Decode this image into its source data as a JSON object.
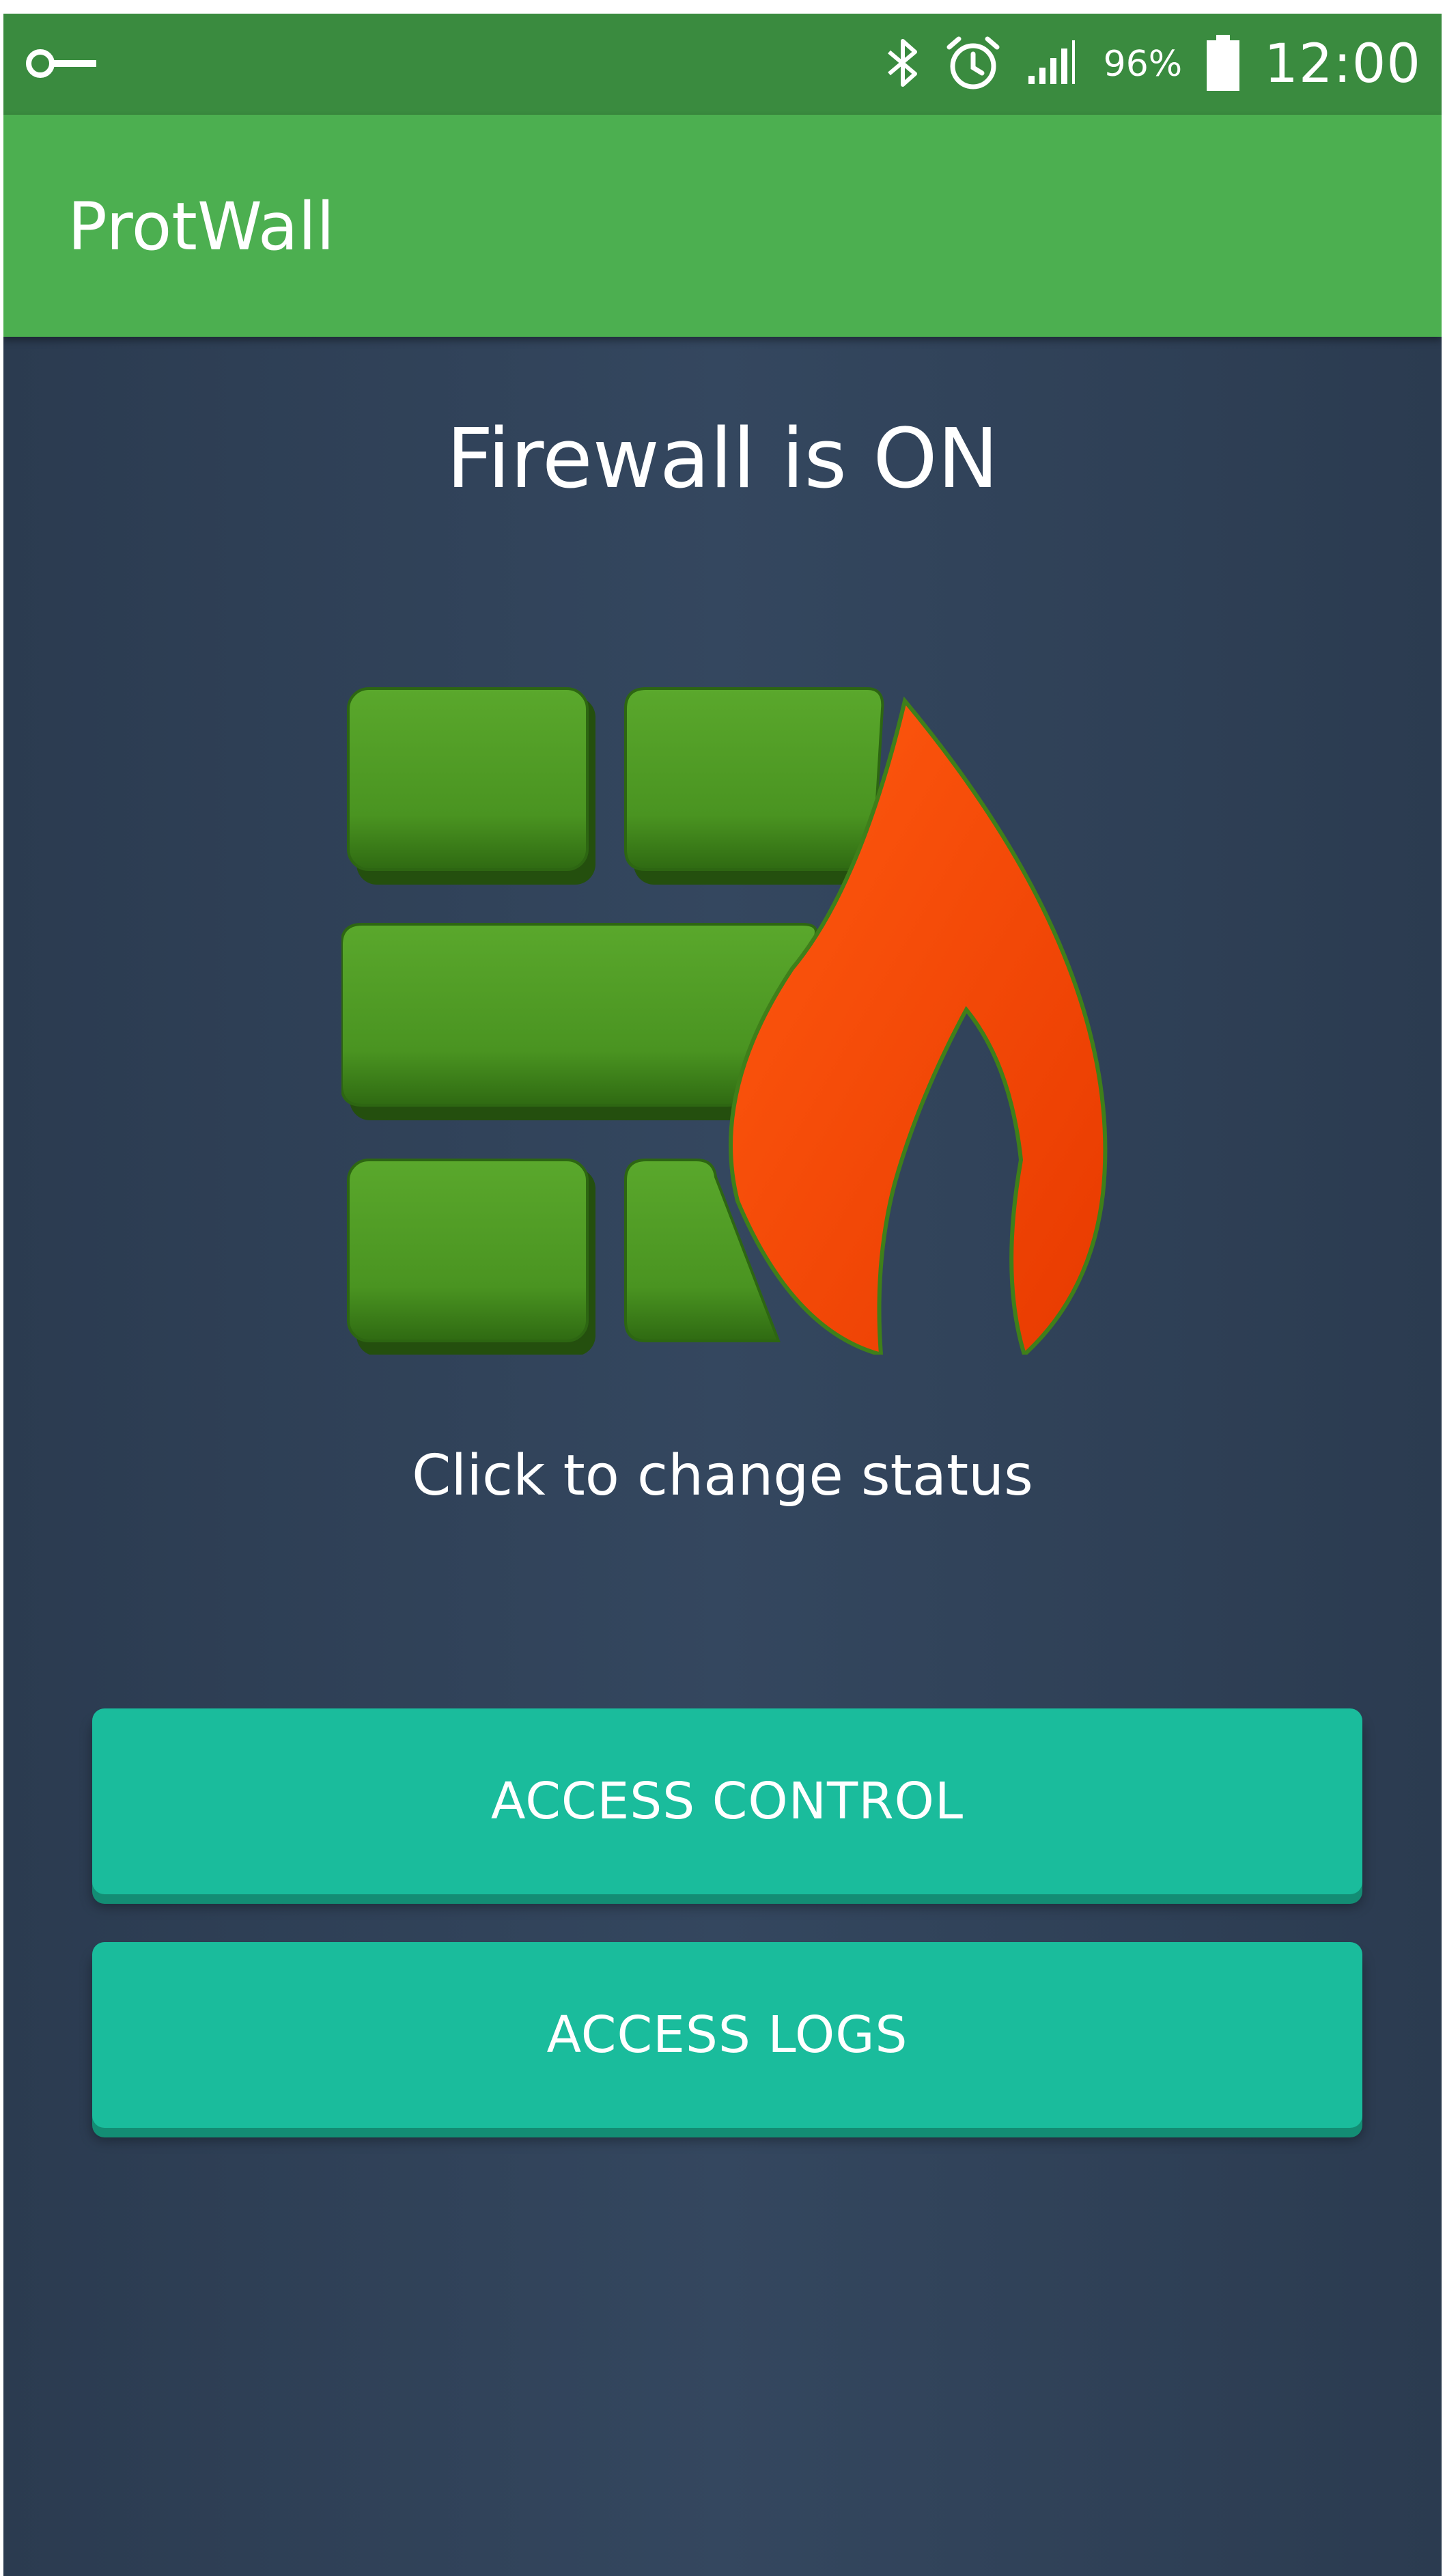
{
  "status_bar": {
    "left_icons": [
      "key-icon"
    ],
    "right_icons": [
      "bluetooth-icon",
      "alarm-icon",
      "signal-icon",
      "battery-icon"
    ],
    "battery_percent": "96%",
    "time": "12:00"
  },
  "app_bar": {
    "title": "ProtWall"
  },
  "main": {
    "status_title": "Firewall is ON",
    "logo_icon": "firewall-logo-icon",
    "hint": "Click to change status",
    "buttons": [
      {
        "label": "ACCESS CONTROL"
      },
      {
        "label": "ACCESS LOGS"
      }
    ]
  },
  "colors": {
    "status_bar": "#3a8b3f",
    "app_bar": "#4caf50",
    "background": "#2f4157",
    "button": "#1abc9c",
    "brick": "#4a9421",
    "flame": "#ff4a00"
  }
}
